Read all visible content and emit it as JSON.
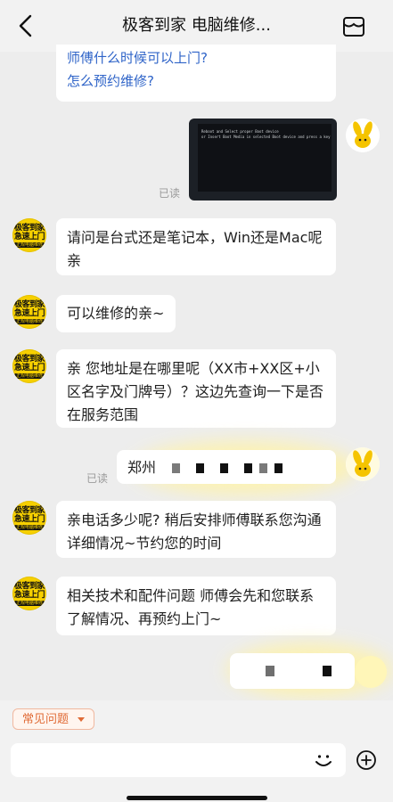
{
  "header": {
    "title": "极客到家 电脑维修...",
    "back_icon": "chevron-left-icon",
    "store_icon": "store-icon"
  },
  "shop_avatar": {
    "line1": "极客到家",
    "line2": "急速上门",
    "line3": "正规电脑维修"
  },
  "messages": {
    "faq_card": {
      "q1": "师傅什么时候可以上门?",
      "q2": "怎么预约维修?"
    },
    "photo_text": "Reboot and Select proper Boot device\nor Insert Boot Media in selected Boot device and press a key",
    "read_label_1": "已读",
    "m1": "请问是台式还是笔记本，Win还是Mac呢亲",
    "m2": "可以维修的亲~",
    "m3": "亲 您地址是在哪里呢（XX市+XX区+小区名字及门牌号）？这边先查询一下是否在服务范围",
    "addr_prefix": "郑州",
    "read_label_2": "已读",
    "m4": "亲电话多少呢? 稍后安排师傅联系您沟通详细情况~节约您的时间",
    "m5": "相关技术和配件问题 师傅会先和您联系 了解情况、再预约上门~"
  },
  "footer": {
    "faq_chip": "常见问题",
    "emoji_icon": "smiley-icon",
    "plus_icon": "plus-circle-icon"
  }
}
